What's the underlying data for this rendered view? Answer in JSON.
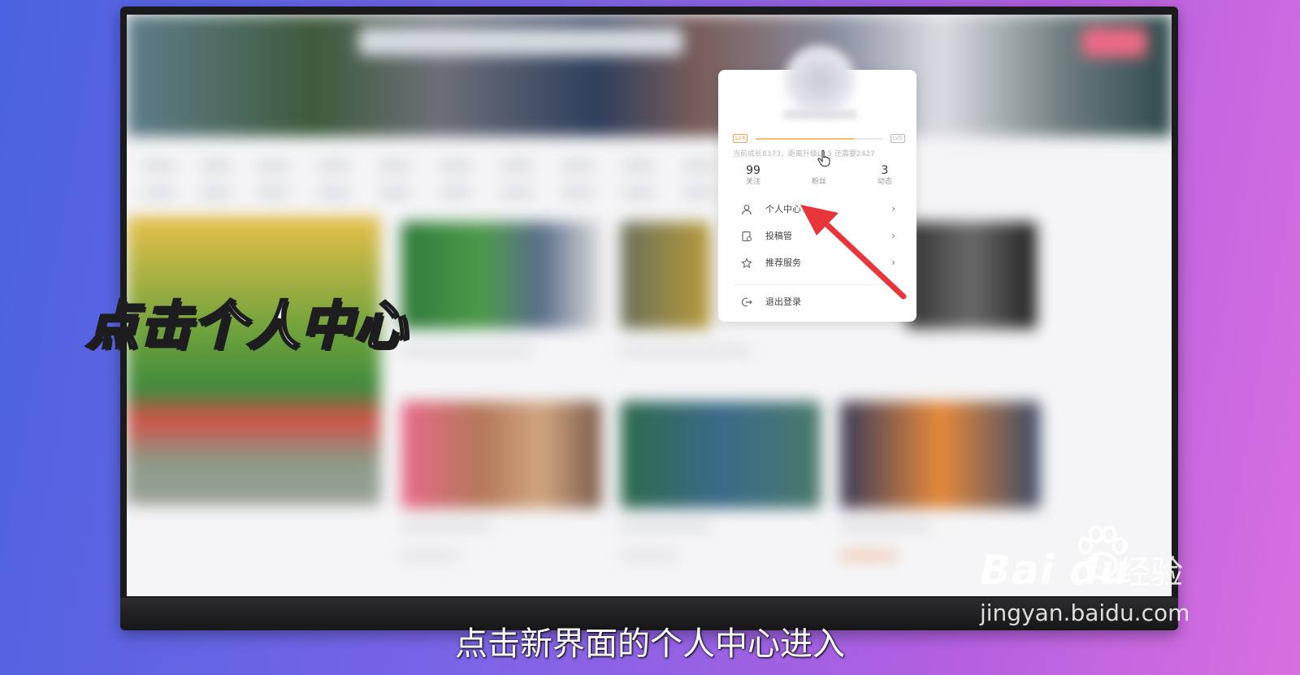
{
  "overlay_title": "点击个人中心",
  "subtitle": "点击新界面的个人中心进入",
  "popover": {
    "level_current": "LV4",
    "level_next": "LV5",
    "level_progress": 0.78,
    "growth_text": "当前成长8373，距离升级Lv.5 还需要2427",
    "stats": [
      {
        "num": "99",
        "label": "关注"
      },
      {
        "num": "",
        "label": "粉丝"
      },
      {
        "num": "3",
        "label": "动态"
      }
    ],
    "menu": [
      {
        "label": "个人中心",
        "icon": "user-icon",
        "arrow": "›"
      },
      {
        "label": "投稿管",
        "icon": "upload-doc-icon",
        "arrow": "›"
      },
      {
        "label": "推荐服务",
        "icon": "star-icon",
        "arrow": "›"
      },
      {
        "label": "退出登录",
        "icon": "logout-icon",
        "arrow": ""
      }
    ]
  },
  "watermark": {
    "logo": "Bai du",
    "brand_cn": "经验",
    "url": "jingyan.baidu.com"
  },
  "colors": {
    "arrow": "#e8353a",
    "level": "#f3a35a",
    "background_start": "#4a63e0",
    "background_end": "#d86fe0"
  }
}
